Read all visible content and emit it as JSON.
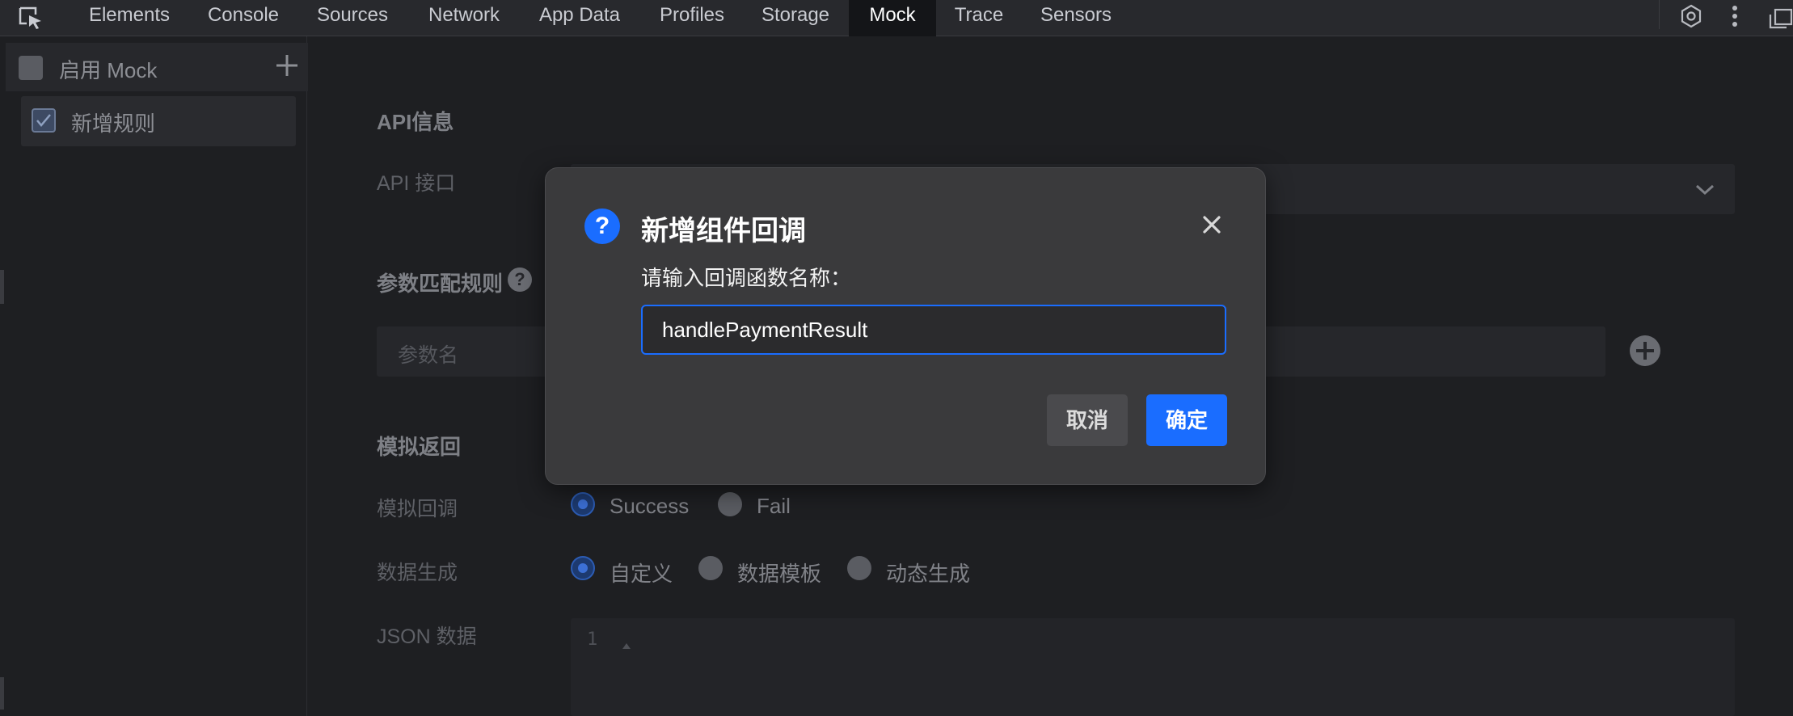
{
  "tabs": [
    {
      "label": "Elements",
      "active": false
    },
    {
      "label": "Console",
      "active": false
    },
    {
      "label": "Sources",
      "active": false
    },
    {
      "label": "Network",
      "active": false
    },
    {
      "label": "App Data",
      "active": false
    },
    {
      "label": "Profiles",
      "active": false
    },
    {
      "label": "Storage",
      "active": false
    },
    {
      "label": "Mock",
      "active": true
    },
    {
      "label": "Trace",
      "active": false
    },
    {
      "label": "Sensors",
      "active": false
    }
  ],
  "sidebar": {
    "enable_label": "启用 Mock",
    "rules": [
      {
        "label": "新增规则",
        "checked": true
      }
    ]
  },
  "form": {
    "api_section": "API信息",
    "api_label": "API 接口",
    "params_section": "参数匹配规则",
    "param_name_placeholder": "参数名",
    "mock_section": "模拟返回",
    "callback_label": "模拟回调",
    "callback_options": [
      "Success",
      "Fail"
    ],
    "callback_selected": "Success",
    "datagen_label": "数据生成",
    "datagen_options": [
      "自定义",
      "数据模板",
      "动态生成"
    ],
    "datagen_selected": "自定义",
    "json_label": "JSON 数据",
    "json_line_number": "1"
  },
  "dialog": {
    "icon": "question-icon",
    "title": "新增组件回调",
    "prompt": "请输入回调函数名称：",
    "input_value": "handlePaymentResult",
    "cancel_label": "取消",
    "ok_label": "确定"
  },
  "colors": {
    "accent": "#1a6dff",
    "background": "#1e1f22",
    "dialog_bg": "#3a3a3c"
  }
}
